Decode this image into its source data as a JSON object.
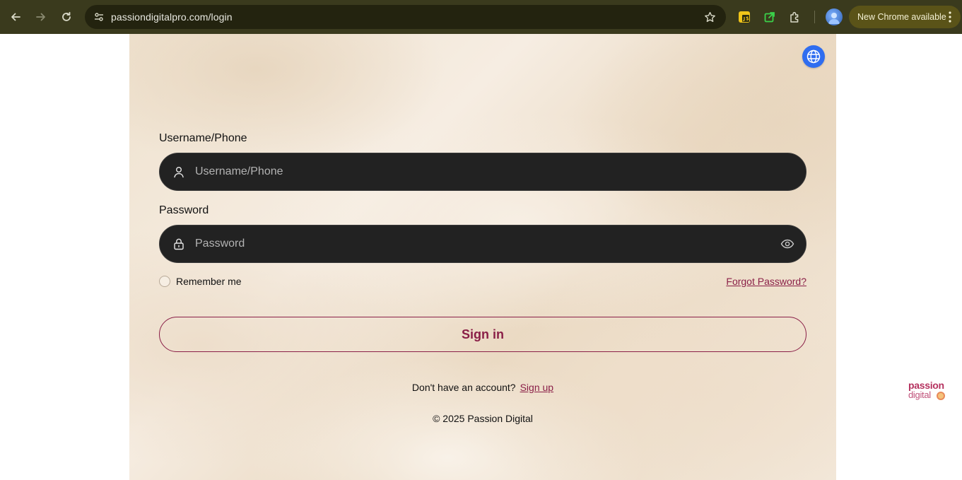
{
  "browser": {
    "url": "passiondigitalpro.com/login",
    "update_label": "New Chrome available"
  },
  "form": {
    "username_label": "Username/Phone",
    "username_placeholder": "Username/Phone",
    "password_label": "Password",
    "password_placeholder": "Password",
    "remember_label": "Remember me",
    "forgot_label": "Forgot Password?",
    "signin_label": "Sign in",
    "no_account_text": "Don't have an account?",
    "signup_label": "Sign up",
    "copyright": "© 2025 Passion Digital"
  },
  "brand": {
    "line1": "passion",
    "line2": "digital"
  },
  "colors": {
    "accent": "#8a1f47",
    "input_bg": "#222222",
    "language_button": "#2f6df0"
  }
}
